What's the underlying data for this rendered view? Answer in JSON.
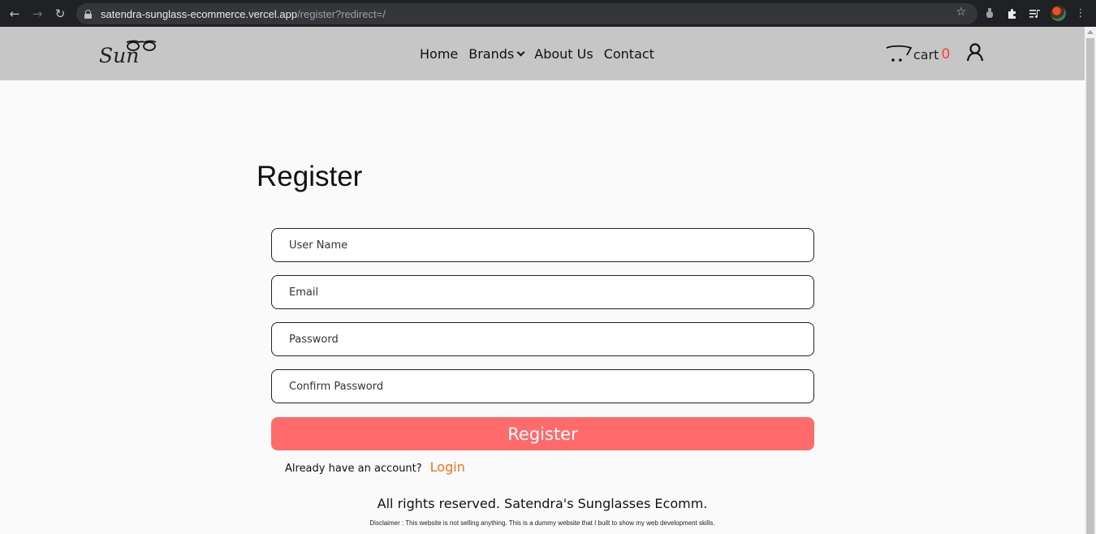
{
  "browser": {
    "url_host": "satendra-sunglass-ecommerce.vercel.app",
    "url_path": "/register?redirect=/"
  },
  "header": {
    "logo_text": "Sun",
    "nav": {
      "home": "Home",
      "brands": "Brands",
      "about": "About Us",
      "contact": "Contact"
    },
    "cart_label": "cart",
    "cart_count": "0"
  },
  "register": {
    "title": "Register",
    "fields": {
      "username_placeholder": "User Name",
      "email_placeholder": "Email",
      "password_placeholder": "Password",
      "confirm_placeholder": "Confirm Password"
    },
    "submit_label": "Register",
    "login_prompt": "Already have an account?",
    "login_link": "Login"
  },
  "footer": {
    "rights": "All rights reserved. Satendra's Sunglasses Ecomm.",
    "disclaimer": "Disclaimer : This website is not selling anything. This is a dummy website that I built to show my web development skills."
  },
  "colors": {
    "header_bg": "#c6c6c6",
    "register_button": "#ff6b6b",
    "login_link": "#e8741c",
    "cart_count": "#ff3b3b"
  }
}
